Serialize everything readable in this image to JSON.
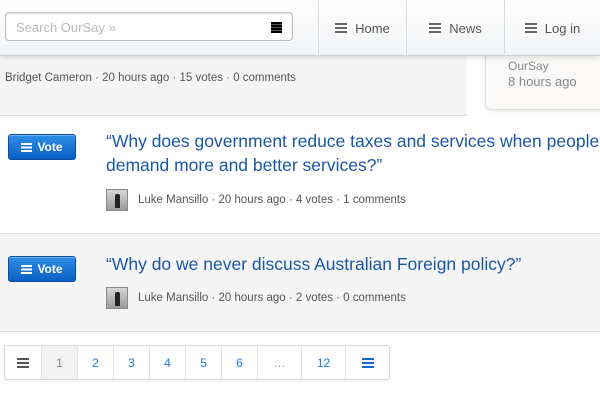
{
  "search": {
    "placeholder": "Search OurSay »"
  },
  "nav": {
    "home_label": "Home",
    "news_label": "News",
    "login_label": "Log in"
  },
  "previous_question": {
    "meta": "Bridget Cameron · 20 hours ago · 15 votes · 0 comments"
  },
  "sidebar": {
    "author": "OurSay",
    "time": "8 hours ago"
  },
  "questions": [
    {
      "vote_label": "Vote",
      "text": "“Why does government reduce taxes and services when people demand more and better services?”",
      "meta": "Luke Mansillo · 20 hours ago · 4 votes · 1 comments"
    },
    {
      "vote_label": "Vote",
      "text": "“Why do we never discuss Australian Foreign policy?”",
      "meta": "Luke Mansillo · 20 hours ago · 2 votes · 0 comments"
    }
  ],
  "pagination": {
    "pages": [
      "1",
      "2",
      "3",
      "4",
      "5",
      "6",
      "…",
      "12"
    ],
    "current": "1"
  },
  "colors": {
    "accent": "#1a57a8",
    "vote_button": "#1668c9",
    "link": "#1e7bd6"
  }
}
